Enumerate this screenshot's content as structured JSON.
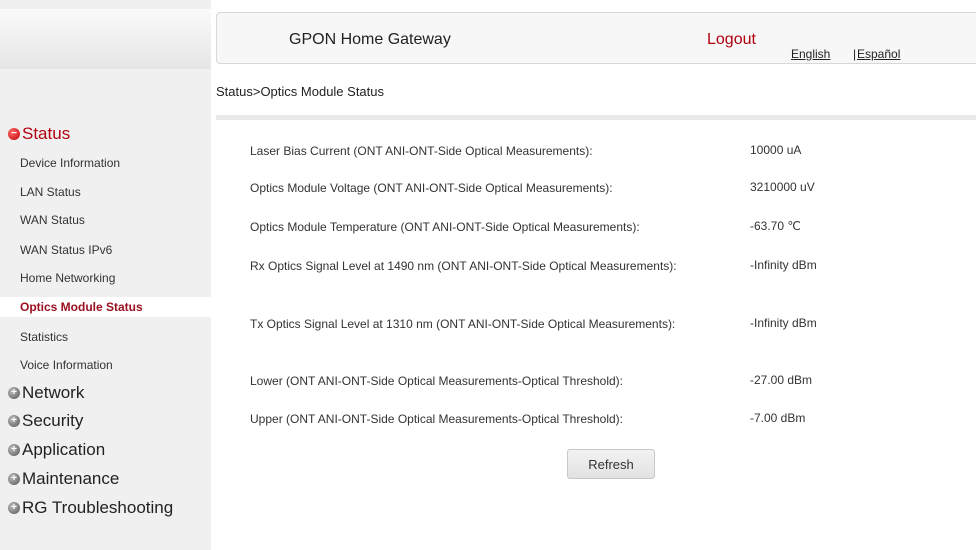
{
  "header": {
    "title": "GPON Home Gateway",
    "logout": "Logout",
    "lang_english": "English",
    "lang_sep": "|",
    "lang_spanish": "Español"
  },
  "breadcrumb": "Status>Optics Module Status",
  "sidebar": {
    "sections": [
      {
        "label": "Status",
        "expanded": true,
        "icon": "minus-circle-icon"
      },
      {
        "label": "Network",
        "expanded": false,
        "icon": "plus-circle-icon"
      },
      {
        "label": "Security",
        "expanded": false,
        "icon": "plus-circle-icon"
      },
      {
        "label": "Application",
        "expanded": false,
        "icon": "plus-circle-icon"
      },
      {
        "label": "Maintenance",
        "expanded": false,
        "icon": "plus-circle-icon"
      },
      {
        "label": "RG Troubleshooting",
        "expanded": false,
        "icon": "plus-circle-icon"
      }
    ],
    "status_items": [
      {
        "label": "Device Information"
      },
      {
        "label": "LAN Status"
      },
      {
        "label": "WAN Status"
      },
      {
        "label": "WAN Status IPv6"
      },
      {
        "label": "Home Networking"
      },
      {
        "label": "Optics Module Status",
        "active": true
      },
      {
        "label": "Statistics"
      },
      {
        "label": "Voice Information"
      }
    ]
  },
  "measurements": [
    {
      "label": "Laser Bias Current (ONT ANI-ONT-Side Optical Measurements):",
      "value": "10000 uA"
    },
    {
      "label": "Optics Module Voltage (ONT ANI-ONT-Side Optical Measurements):",
      "value": "3210000 uV"
    },
    {
      "label": "Optics Module Temperature (ONT ANI-ONT-Side Optical Measurements):",
      "value": "-63.70 ℃"
    },
    {
      "label": "Rx Optics Signal Level at 1490 nm (ONT ANI-ONT-Side Optical Measurements):",
      "value": "-Infinity dBm"
    },
    {
      "label": "Tx Optics Signal Level at 1310 nm (ONT ANI-ONT-Side Optical Measurements):",
      "value": "-Infinity dBm"
    },
    {
      "label": "Lower (ONT ANI-ONT-Side Optical Measurements-Optical Threshold):",
      "value": "-27.00 dBm"
    },
    {
      "label": "Upper (ONT ANI-ONT-Side Optical Measurements-Optical Threshold):",
      "value": "-7.00 dBm"
    }
  ],
  "refresh_label": "Refresh",
  "colors": {
    "accent": "#b00010",
    "sidebar_bg": "#f0f0f0"
  }
}
